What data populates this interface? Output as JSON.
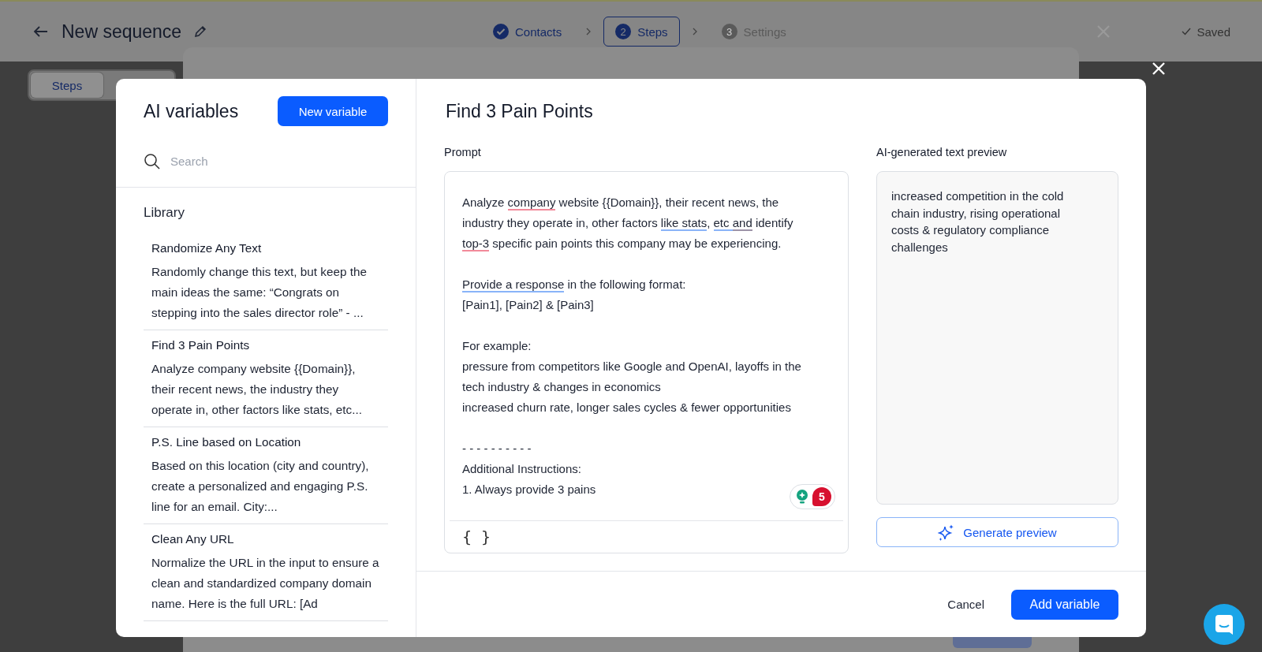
{
  "app_bar": {
    "title": "New sequence",
    "steps": [
      {
        "label": "Contacts",
        "done": true,
        "selected": false
      },
      {
        "number": "2",
        "label": "Steps",
        "done": false,
        "selected": true
      },
      {
        "number": "3",
        "label": "Settings",
        "done": false,
        "selected": false
      }
    ],
    "status": "Saved"
  },
  "background_tabs": [
    {
      "label": "Steps",
      "selected": true
    }
  ],
  "modal": {
    "title": "AI variables",
    "new_button": "New variable",
    "search": {
      "placeholder": "Search"
    },
    "library_heading": "Library",
    "library": [
      {
        "title": "Randomize Any Text",
        "description": "Randomly change this text, but keep the main ideas the same: “Congrats on stepping into the sales director role” - ..."
      },
      {
        "title": "Find 3 Pain Points",
        "description": "Analyze company website {{Domain}}, their recent news, the industry they operate in, other factors like stats, etc..."
      },
      {
        "title": "P.S. Line based on Location",
        "description": "Based on this location (city and country), create a personalized and engaging P.S. line for an email. City:..."
      },
      {
        "title": "Clean Any URL",
        "description": "Normalize the URL in the input to ensure a clean and standardized company domain name. Here is the full URL: [Ad"
      }
    ],
    "editor": {
      "title": "Find 3 Pain Points",
      "prompt_label": "Prompt",
      "prompt": [
        [
          [
            {
              "text": "Analyze "
            },
            {
              "text": "company",
              "kind": "spelling"
            },
            {
              "text": " website {{Domain}}, their recent news, the"
            }
          ],
          [
            {
              "text": "industry they operate in, other factors "
            },
            {
              "text": "like stats",
              "kind": "clarity"
            },
            {
              "text": ", "
            },
            {
              "text": "etc ",
              "kind": "clarity"
            },
            {
              "text": "and",
              "kind": "style"
            },
            {
              "text": " identify"
            }
          ],
          [
            {
              "text": "top-3",
              "kind": "spelling"
            },
            {
              "text": " specific pain points this company may be experiencing."
            }
          ]
        ],
        [
          [
            {
              "text": "Provide a response",
              "kind": "clarity"
            },
            {
              "text": " in the following format:"
            }
          ],
          [
            {
              "text": "[Pain1], [Pain2] & [Pain3]"
            }
          ]
        ],
        [
          [
            {
              "text": "For example:"
            }
          ],
          [
            {
              "text": "pressure from competitors like Google and OpenAI, layoffs in the"
            }
          ],
          [
            {
              "text": "tech industry & changes in economics"
            }
          ],
          [
            {
              "text": "increased churn rate, longer sales cycles & fewer opportunities"
            }
          ]
        ],
        [
          [
            {
              "text": "- - - - - - - - - -"
            }
          ],
          [
            {
              "text": "Additional Instructions:"
            }
          ],
          [
            {
              "text": "1. Always provide 3 pains"
            }
          ]
        ]
      ],
      "grammar_badge": {
        "count": "5"
      },
      "variable_button": "{ }",
      "preview_label": "AI-generated text preview",
      "preview_text": "increased competition in the cold chain industry, rising operational costs & regulatory compliance challenges",
      "generate_button": "Generate preview",
      "cancel_button": "Cancel",
      "add_button": "Add variable"
    }
  }
}
